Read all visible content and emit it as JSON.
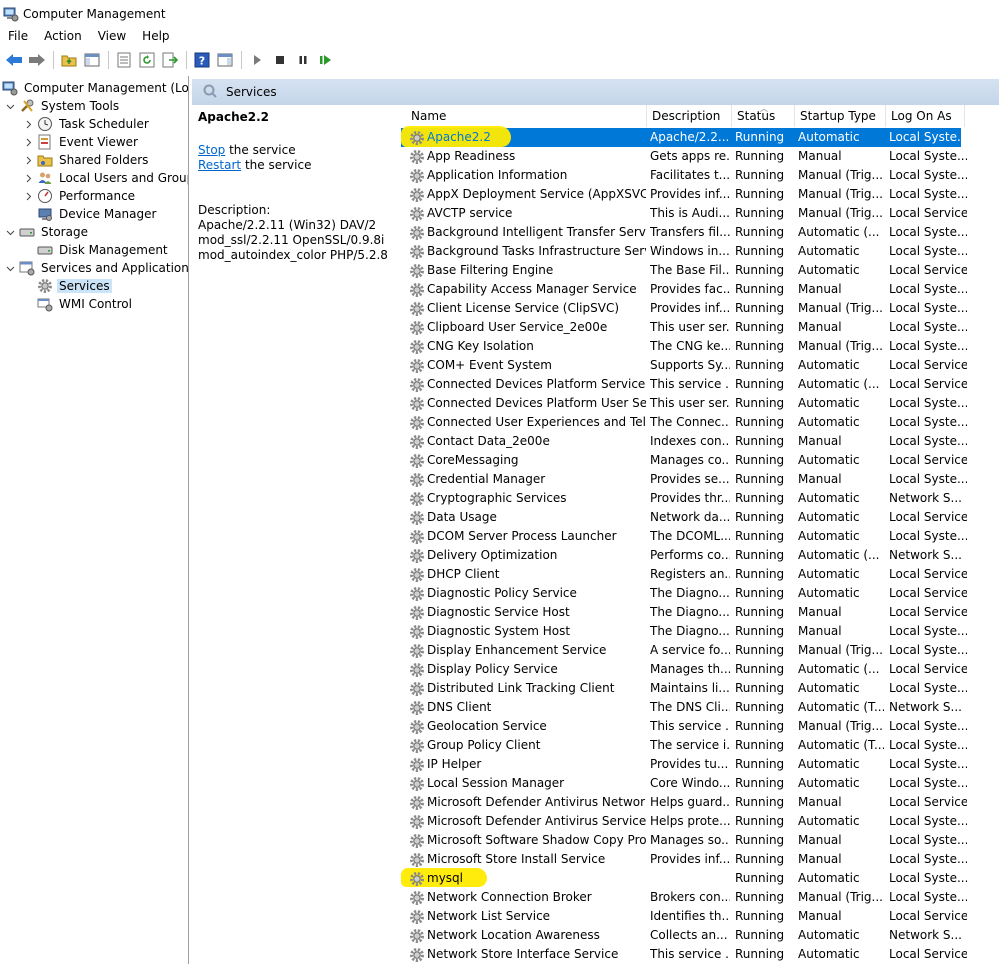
{
  "window": {
    "title": "Computer Management"
  },
  "menu": [
    "File",
    "Action",
    "View",
    "Help"
  ],
  "toolbar": [
    "back-icon",
    "forward-icon",
    "up-folder-icon",
    "show-hide-tree-icon",
    "properties-icon",
    "refresh-icon",
    "export-icon",
    "help-icon",
    "show-hide-action-icon",
    "play-icon",
    "stop-icon",
    "pause-icon",
    "resume-icon"
  ],
  "tree": {
    "root": "Computer Management (Local",
    "system_tools": "System Tools",
    "task_scheduler": "Task Scheduler",
    "event_viewer": "Event Viewer",
    "shared_folders": "Shared Folders",
    "local_users": "Local Users and Groups",
    "performance": "Performance",
    "device_manager": "Device Manager",
    "storage": "Storage",
    "disk_management": "Disk Management",
    "services_apps": "Services and Applications",
    "services": "Services",
    "wmi": "WMI Control"
  },
  "pane_header": "Services",
  "details": {
    "title": "Apache2.2",
    "stop_link": "Stop",
    "stop_rest": " the service",
    "restart_link": "Restart",
    "restart_rest": " the service",
    "description_label": "Description:",
    "description_lines": [
      "Apache/2.2.11 (Win32) DAV/2",
      "mod_ssl/2.2.11 OpenSSL/0.9.8i",
      "mod_autoindex_color PHP/5.2.8"
    ]
  },
  "columns": {
    "name": "Name",
    "description": "Description",
    "status": "Status",
    "startup": "Startup Type",
    "logon": "Log On As"
  },
  "highlight_color": "#ffeb00",
  "selection_color": "#0078d7",
  "services": [
    [
      "Apache2.2",
      "Apache/2.2....",
      "Running",
      "Automatic",
      "Local Syste..."
    ],
    [
      "App Readiness",
      "Gets apps re...",
      "Running",
      "Manual",
      "Local Syste..."
    ],
    [
      "Application Information",
      "Facilitates t...",
      "Running",
      "Manual (Trig...",
      "Local Syste..."
    ],
    [
      "AppX Deployment Service (AppXSVC)",
      "Provides inf...",
      "Running",
      "Manual (Trig...",
      "Local Syste..."
    ],
    [
      "AVCTP service",
      "This is Audi...",
      "Running",
      "Manual (Trig...",
      "Local Service"
    ],
    [
      "Background Intelligent Transfer Service",
      "Transfers fil...",
      "Running",
      "Automatic (...",
      "Local Syste..."
    ],
    [
      "Background Tasks Infrastructure Service",
      "Windows in...",
      "Running",
      "Automatic",
      "Local Syste..."
    ],
    [
      "Base Filtering Engine",
      "The Base Fil...",
      "Running",
      "Automatic",
      "Local Service"
    ],
    [
      "Capability Access Manager Service",
      "Provides fac...",
      "Running",
      "Manual",
      "Local Syste..."
    ],
    [
      "Client License Service (ClipSVC)",
      "Provides inf...",
      "Running",
      "Manual (Trig...",
      "Local Syste..."
    ],
    [
      "Clipboard User Service_2e00e",
      "This user ser...",
      "Running",
      "Manual",
      "Local Syste..."
    ],
    [
      "CNG Key Isolation",
      "The CNG ke...",
      "Running",
      "Manual (Trig...",
      "Local Syste..."
    ],
    [
      "COM+ Event System",
      "Supports Sy...",
      "Running",
      "Automatic",
      "Local Service"
    ],
    [
      "Connected Devices Platform Service",
      "This service ...",
      "Running",
      "Automatic (...",
      "Local Service"
    ],
    [
      "Connected Devices Platform User Serv...",
      "This user ser...",
      "Running",
      "Automatic",
      "Local Syste..."
    ],
    [
      "Connected User Experiences and Tele...",
      "The Connec...",
      "Running",
      "Automatic",
      "Local Syste..."
    ],
    [
      "Contact Data_2e00e",
      "Indexes con...",
      "Running",
      "Manual",
      "Local Syste..."
    ],
    [
      "CoreMessaging",
      "Manages co...",
      "Running",
      "Automatic",
      "Local Service"
    ],
    [
      "Credential Manager",
      "Provides se...",
      "Running",
      "Manual",
      "Local Syste..."
    ],
    [
      "Cryptographic Services",
      "Provides thr...",
      "Running",
      "Automatic",
      "Network S..."
    ],
    [
      "Data Usage",
      "Network da...",
      "Running",
      "Automatic",
      "Local Service"
    ],
    [
      "DCOM Server Process Launcher",
      "The DCOML...",
      "Running",
      "Automatic",
      "Local Syste..."
    ],
    [
      "Delivery Optimization",
      "Performs co...",
      "Running",
      "Automatic (...",
      "Network S..."
    ],
    [
      "DHCP Client",
      "Registers an...",
      "Running",
      "Automatic",
      "Local Service"
    ],
    [
      "Diagnostic Policy Service",
      "The Diagno...",
      "Running",
      "Automatic",
      "Local Service"
    ],
    [
      "Diagnostic Service Host",
      "The Diagno...",
      "Running",
      "Manual",
      "Local Service"
    ],
    [
      "Diagnostic System Host",
      "The Diagno...",
      "Running",
      "Manual",
      "Local Syste..."
    ],
    [
      "Display Enhancement Service",
      "A service fo...",
      "Running",
      "Manual (Trig...",
      "Local Syste..."
    ],
    [
      "Display Policy Service",
      "Manages th...",
      "Running",
      "Automatic (...",
      "Local Service"
    ],
    [
      "Distributed Link Tracking Client",
      "Maintains li...",
      "Running",
      "Automatic",
      "Local Syste..."
    ],
    [
      "DNS Client",
      "The DNS Cli...",
      "Running",
      "Automatic (T...",
      "Network S..."
    ],
    [
      "Geolocation Service",
      "This service ...",
      "Running",
      "Manual (Trig...",
      "Local Syste..."
    ],
    [
      "Group Policy Client",
      "The service i...",
      "Running",
      "Automatic (T...",
      "Local Syste..."
    ],
    [
      "IP Helper",
      "Provides tu...",
      "Running",
      "Automatic",
      "Local Syste..."
    ],
    [
      "Local Session Manager",
      "Core Windo...",
      "Running",
      "Automatic",
      "Local Syste..."
    ],
    [
      "Microsoft Defender Antivirus Network ...",
      "Helps guard...",
      "Running",
      "Manual",
      "Local Service"
    ],
    [
      "Microsoft Defender Antivirus Service",
      "Helps prote...",
      "Running",
      "Automatic",
      "Local Syste..."
    ],
    [
      "Microsoft Software Shadow Copy Prov...",
      "Manages so...",
      "Running",
      "Manual",
      "Local Syste..."
    ],
    [
      "Microsoft Store Install Service",
      "Provides inf...",
      "Running",
      "Manual",
      "Local Syste..."
    ],
    [
      "mysql",
      "",
      "Running",
      "Automatic",
      "Local Syste..."
    ],
    [
      "Network Connection Broker",
      "Brokers con...",
      "Running",
      "Manual (Trig...",
      "Local Syste..."
    ],
    [
      "Network List Service",
      "Identifies th...",
      "Running",
      "Manual",
      "Local Service"
    ],
    [
      "Network Location Awareness",
      "Collects an...",
      "Running",
      "Automatic",
      "Network S..."
    ],
    [
      "Network Store Interface Service",
      "This service ...",
      "Running",
      "Automatic",
      "Local Service"
    ]
  ]
}
